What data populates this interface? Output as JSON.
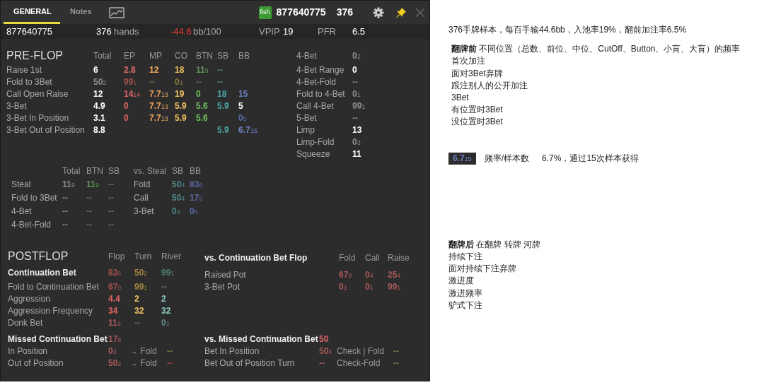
{
  "header": {
    "tabs": [
      {
        "label": "GENERAL",
        "selected": true
      },
      {
        "label": "Notes",
        "selected": false
      }
    ],
    "tag": {
      "text": "fish",
      "color": "#3d9b35"
    },
    "player": "877640775",
    "hands": "376"
  },
  "summary": {
    "player": "877640775",
    "hands": "376",
    "hands_label": "hands",
    "winrate": "-44.6",
    "winrate_unit": "bb/100",
    "vpip_label": "VPIP",
    "vpip": "19",
    "pfr_label": "PFR",
    "pfr": "6.5"
  },
  "preflop": {
    "title": "PRE-FLOP",
    "columns": [
      "Total",
      "EP",
      "MP",
      "CO",
      "BTN",
      "SB",
      "BB"
    ],
    "rows": [
      {
        "label": "Raise 1st",
        "cells": [
          {
            "v": "6",
            "color": "#ffffff"
          },
          {
            "v": "2.8",
            "color": "#e06666"
          },
          {
            "v": "12",
            "color": "#f0a860"
          },
          {
            "v": "18",
            "color": "#f0c060"
          },
          {
            "v": "11",
            "n": "9",
            "color": "#5f9455"
          },
          {
            "v": "--",
            "color": "#4f8a8a"
          },
          null
        ]
      },
      {
        "label": "Fold to 3Bet",
        "cells": [
          {
            "v": "50",
            "n": "2",
            "color": "#8a8a8a"
          },
          {
            "v": "99",
            "n": "1",
            "color": "#a05050"
          },
          {
            "v": "--",
            "color": "#8a6a40"
          },
          {
            "v": "0",
            "n": "1",
            "color": "#8a7a40"
          },
          {
            "v": "--",
            "color": "#6a6a6a"
          },
          {
            "v": "--",
            "color": "#4f8a8a"
          },
          null
        ]
      },
      {
        "label": "Call Open Raise",
        "cells": [
          {
            "v": "12",
            "color": "#ffffff"
          },
          {
            "v": "14",
            "n": "14",
            "color": "#e06666"
          },
          {
            "v": "7.7",
            "n": "13",
            "color": "#f0a860"
          },
          {
            "v": "19",
            "color": "#f0c060"
          },
          {
            "v": "0",
            "color": "#6fbf5f"
          },
          {
            "v": "18",
            "color": "#4aa5a5"
          },
          {
            "v": "15",
            "color": "#6a7fc0"
          }
        ]
      },
      {
        "label": "3-Bet",
        "cells": [
          {
            "v": "4.9",
            "color": "#ffffff"
          },
          {
            "v": "0",
            "color": "#e06666"
          },
          {
            "v": "7.7",
            "n": "13",
            "color": "#f0a860"
          },
          {
            "v": "5.9",
            "color": "#f0c060"
          },
          {
            "v": "5.6",
            "color": "#6fbf5f"
          },
          {
            "v": "5.9",
            "color": "#4aa5a5"
          },
          {
            "v": "5",
            "color": "#ffffff"
          }
        ]
      },
      {
        "label": "3-Bet In Position",
        "cells": [
          {
            "v": "3.1",
            "color": "#ffffff"
          },
          {
            "v": "0",
            "color": "#e06666"
          },
          {
            "v": "7.7",
            "n": "13",
            "color": "#f0a860"
          },
          {
            "v": "5.9",
            "color": "#f0c060"
          },
          {
            "v": "5.6",
            "color": "#6fbf5f"
          },
          null,
          {
            "v": "0",
            "n": "5",
            "color": "#5a6aa0"
          }
        ]
      },
      {
        "label": "3-Bet Out of Position",
        "cells": [
          {
            "v": "8.8",
            "color": "#ffffff"
          },
          null,
          null,
          null,
          null,
          {
            "v": "5.9",
            "color": "#4aa5a5"
          },
          {
            "v": "6.7",
            "n": "15",
            "color": "#6a7fc0"
          }
        ]
      }
    ]
  },
  "preflop_more": [
    {
      "label": "4-Bet",
      "value": {
        "v": "0",
        "n": "2",
        "color": "#8a8a8a"
      }
    },
    {
      "label": "4-Bet Range",
      "value": {
        "v": "0",
        "color": "#ffffff"
      }
    },
    {
      "label": "4-Bet-Fold",
      "value": {
        "v": "--",
        "color": "#8a8a8a"
      }
    },
    {
      "label": "Fold to 4-Bet",
      "value": {
        "v": "0",
        "n": "1",
        "color": "#8a8a8a"
      }
    },
    {
      "label": "Call 4-Bet",
      "value": {
        "v": "99",
        "n": "1",
        "color": "#8a8a8a"
      }
    },
    {
      "label": "5-Bet",
      "value": {
        "v": "--",
        "color": "#8a8a8a"
      }
    },
    {
      "label": "Limp",
      "value": {
        "v": "13",
        "color": "#ffffff"
      }
    },
    {
      "label": "Limp-Fold",
      "value": {
        "v": "0",
        "n": "3",
        "color": "#8a8a8a"
      }
    },
    {
      "label": "Squeeze",
      "value": {
        "v": "11",
        "color": "#ffffff"
      }
    }
  ],
  "steal": {
    "columns": [
      "Total",
      "BTN",
      "SB"
    ],
    "rows": [
      {
        "label": "Steal",
        "cells": [
          {
            "v": "11",
            "n": "9",
            "color": "#8a8a8a"
          },
          {
            "v": "11",
            "n": "9",
            "color": "#5f9455"
          },
          {
            "v": "--",
            "color": "#6a6a6a"
          }
        ]
      },
      {
        "label": "Fold to 3Bet",
        "cells": [
          {
            "v": "--",
            "color": "#8a8a8a"
          },
          {
            "v": "--",
            "color": "#6a6a6a"
          },
          {
            "v": "--",
            "color": "#6a6a6a"
          }
        ]
      },
      {
        "label": "4-Bet",
        "cells": [
          {
            "v": "--",
            "color": "#8a8a8a"
          },
          {
            "v": "--",
            "color": "#6a6a6a"
          },
          {
            "v": "--",
            "color": "#6a6a6a"
          }
        ]
      },
      {
        "label": "4-Bet-Fold",
        "cells": [
          {
            "v": "--",
            "color": "#8a8a8a"
          },
          {
            "v": "--",
            "color": "#6a6a6a"
          },
          {
            "v": "--",
            "color": "#6a6a6a"
          }
        ]
      }
    ]
  },
  "vs_steal": {
    "title": "vs. Steal",
    "columns": [
      "SB",
      "BB"
    ],
    "rows": [
      {
        "label": "Fold",
        "cells": [
          {
            "v": "50",
            "n": "4",
            "color": "#4f8a8a"
          },
          {
            "v": "83",
            "n": "6",
            "color": "#5a6aa0"
          }
        ]
      },
      {
        "label": "Call",
        "cells": [
          {
            "v": "50",
            "n": "4",
            "color": "#4f8a8a"
          },
          {
            "v": "17",
            "n": "6",
            "color": "#5a6aa0"
          }
        ]
      },
      {
        "label": "3-Bet",
        "cells": [
          {
            "v": "0",
            "n": "4",
            "color": "#4f8a8a"
          },
          {
            "v": "0",
            "n": "6",
            "color": "#5a6aa0"
          }
        ]
      }
    ]
  },
  "postflop": {
    "title": "POSTFLOP",
    "columns": [
      "Flop",
      "Turn",
      "River"
    ],
    "rows": [
      {
        "label": "Continuation Bet",
        "strong": true,
        "cells": [
          {
            "v": "83",
            "n": "6",
            "color": "#a05050"
          },
          {
            "v": "50",
            "n": "2",
            "color": "#a08040"
          },
          {
            "v": "99",
            "n": "1",
            "color": "#4f7a70"
          }
        ]
      },
      {
        "label": "Fold to Continuation Bet",
        "strong": false,
        "cells": [
          {
            "v": "67",
            "n": "9",
            "color": "#a05050"
          },
          {
            "v": "99",
            "n": "1",
            "color": "#a08040"
          },
          {
            "v": "--",
            "color": "#6a6a6a"
          }
        ]
      },
      {
        "label": "Aggression",
        "strong": false,
        "cells": [
          {
            "v": "4.4",
            "color": "#e06666"
          },
          {
            "v": "2",
            "color": "#f0c060"
          },
          {
            "v": "2",
            "color": "#8fc8c0"
          }
        ]
      },
      {
        "label": "Aggression Frequency",
        "strong": false,
        "cells": [
          {
            "v": "34",
            "color": "#e06666"
          },
          {
            "v": "32",
            "color": "#f0c060"
          },
          {
            "v": "32",
            "color": "#8fc8c0"
          }
        ]
      },
      {
        "label": "Donk Bet",
        "strong": false,
        "cells": [
          {
            "v": "11",
            "n": "9",
            "color": "#a85a5a"
          },
          {
            "v": "--",
            "color": "#6a6a6a"
          },
          {
            "v": "0",
            "n": "1",
            "color": "#5f8a84"
          }
        ]
      }
    ]
  },
  "vs_cbet": {
    "title": "vs. Continuation Bet Flop",
    "columns": [
      "Fold",
      "Call",
      "Raise"
    ],
    "rows": [
      {
        "label": "Raised Pot",
        "cells": [
          {
            "v": "67",
            "n": "9",
            "color": "#a85a5a"
          },
          {
            "v": "0",
            "n": "4",
            "color": "#a85a5a"
          },
          {
            "v": "25",
            "n": "4",
            "color": "#a85a5a"
          }
        ]
      },
      {
        "label": "3-Bet Pot",
        "cells": [
          {
            "v": "0",
            "n": "1",
            "color": "#a85a5a"
          },
          {
            "v": "0",
            "n": "1",
            "color": "#a85a5a"
          },
          {
            "v": "99",
            "n": "1",
            "color": "#a85a5a"
          }
        ]
      }
    ]
  },
  "missed_cbet": {
    "title": "Missed Continuation Bet",
    "value": {
      "v": "17",
      "n": "6",
      "color": "#a85a5a"
    },
    "rows": [
      {
        "label": "In Position",
        "cells": [
          {
            "kind": "stat",
            "v": "0",
            "n": "3",
            "color": "#a85a5a"
          },
          {
            "kind": "label",
            "v": "→ Fold",
            "color": "#9a9a9a"
          },
          {
            "kind": "stat",
            "v": "--",
            "color": "#7a7a40"
          }
        ]
      },
      {
        "label": "Out of Position",
        "cells": [
          {
            "kind": "stat",
            "v": "50",
            "n": "2",
            "color": "#a85a5a"
          },
          {
            "kind": "label",
            "v": "→ Fold",
            "color": "#9a9a9a"
          },
          {
            "kind": "stat",
            "v": "--",
            "color": "#a04040"
          }
        ]
      }
    ]
  },
  "vs_missed_cbet": {
    "title": "vs. Missed Continuation Bet",
    "value": {
      "v": "50",
      "color": "#e06666"
    },
    "rows": [
      {
        "label": "Bet In Position",
        "cells": [
          {
            "kind": "stat",
            "v": "50",
            "n": "4",
            "color": "#a85a5a"
          },
          {
            "kind": "label",
            "v": "Check | Fold",
            "color": "#9a9a9a"
          },
          {
            "kind": "stat",
            "v": "--",
            "color": "#7a7a40"
          }
        ]
      },
      {
        "label": "Bet Out of Position Turn",
        "cells": [
          {
            "kind": "stat",
            "v": "--",
            "color": "#a85a5a"
          },
          {
            "kind": "label",
            "v": "Check-Fold",
            "color": "#9a9a9a"
          },
          {
            "kind": "stat",
            "v": "--",
            "color": "#7a7a40"
          }
        ]
      }
    ]
  },
  "notes": {
    "summary": "376手牌样本，每百手输44.6bb，入池率19%，翻前加注率6.5%",
    "preflop_heading": "**翻牌前** 不同位置（总数、前位、中位、CutOff、Button、小盲、大盲）的频率",
    "preflop_lines": [
      "首次加注",
      "面对3Bet弃牌",
      "跟注别人的公开加注",
      "3Bet",
      "有位置时3Bet",
      "没位置时3Bet"
    ],
    "legend": {
      "sample": {
        "v": "6.7",
        "n": "15",
        "color": "#6a7fc0"
      },
      "caption": "频率/样本数",
      "explanation": "6.7%，通过15次样本获得"
    },
    "postflop_heading": "**翻牌后** 在翻牌 转牌 河牌",
    "postflop_lines": [
      "持续下注",
      "面对持续下注弃牌",
      "激进度",
      "激进频率",
      "驴式下注"
    ]
  }
}
